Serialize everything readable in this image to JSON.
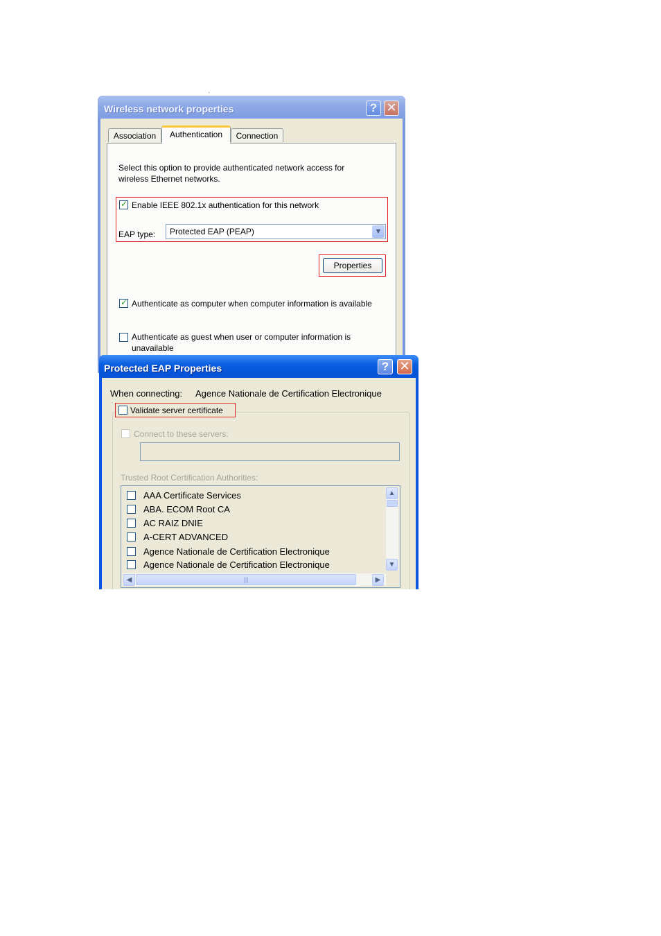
{
  "wireless_window": {
    "title": "Wireless network properties",
    "help_glyph": "?",
    "close_glyph": "✕",
    "tabs": [
      {
        "label": "Association",
        "active": false
      },
      {
        "label": "Authentication",
        "active": true
      },
      {
        "label": "Connection",
        "active": false
      }
    ],
    "description_line1": "Select this option to provide authenticated network access for",
    "description_line2": "wireless Ethernet networks.",
    "enable_8021x": {
      "label": "Enable IEEE 802.1x authentication for this network",
      "checked": true
    },
    "eap_type_label": "EAP type:",
    "eap_type_value": "Protected EAP (PEAP)",
    "properties_button": "Properties",
    "auth_as_computer": {
      "label": "Authenticate as computer when computer information is available",
      "checked": true
    },
    "auth_as_guest": {
      "label_line1": "Authenticate as guest when user or computer information is",
      "label_line2": "unavailable",
      "checked": false
    }
  },
  "peap_window": {
    "title": "Protected EAP Properties",
    "help_glyph": "?",
    "close_glyph": "✕",
    "when_connecting_label": "When connecting:",
    "when_connecting_value": "Agence Nationale de Certification Electronique",
    "validate_server_cert": {
      "label": "Validate server certificate",
      "checked": false
    },
    "connect_to_servers": {
      "label": "Connect to these servers:",
      "checked": false,
      "enabled": false
    },
    "servers_input_value": "",
    "trusted_roots_label": "Trusted Root Certification Authorities:",
    "certificate_authorities": [
      {
        "label": "AAA Certificate Services",
        "checked": false
      },
      {
        "label": "ABA. ECOM Root CA",
        "checked": false
      },
      {
        "label": "AC RAIZ DNIE",
        "checked": false
      },
      {
        "label": "A-CERT ADVANCED",
        "checked": false
      },
      {
        "label": "Agence Nationale de Certification Electronique",
        "checked": false
      },
      {
        "label": "Agence Nationale de Certification Electronique",
        "checked": false
      }
    ],
    "scroll_up_glyph": "▲",
    "scroll_down_glyph": "▼",
    "scroll_left_glyph": "◀",
    "scroll_right_glyph": "▶",
    "scroll_grip": "|||"
  },
  "colors": {
    "highlight_box": "#e02020",
    "inactive_title": "#8ea9e6",
    "active_title": "#0a5fe0",
    "dialog_face": "#ece9d8"
  }
}
